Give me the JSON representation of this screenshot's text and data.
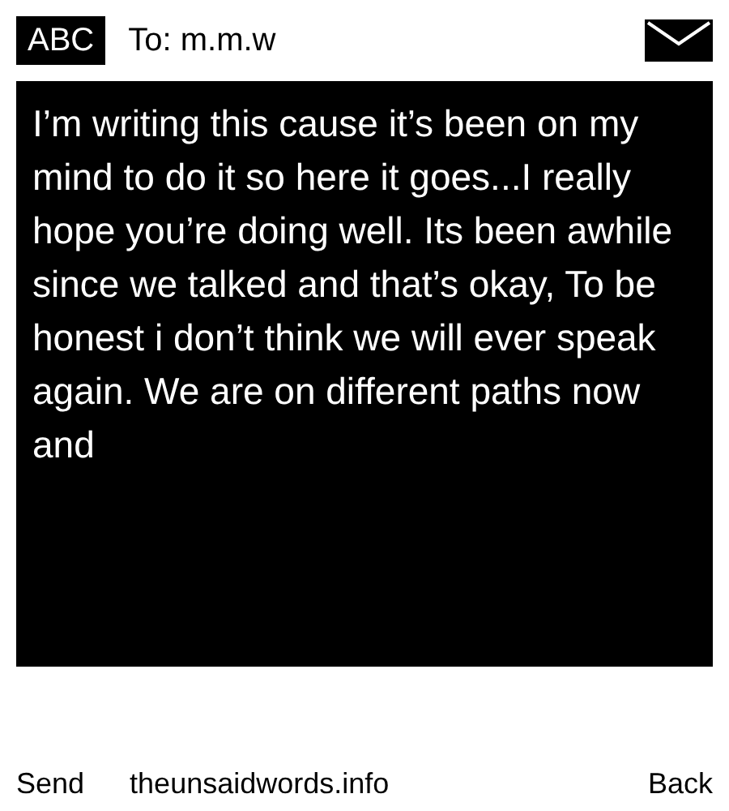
{
  "header": {
    "badge": "ABC",
    "recipient": "To: m.m.w"
  },
  "message": {
    "text": "I’m writing this cause it’s been on my mind to do it so here it goes...I really hope you’re doing well. Its been awhile since we talked and that’s okay, To be honest i don’t think we will ever speak again. We are on different paths now and"
  },
  "footer": {
    "send": "Send",
    "site": "theunsaidwords.info",
    "back": "Back"
  }
}
